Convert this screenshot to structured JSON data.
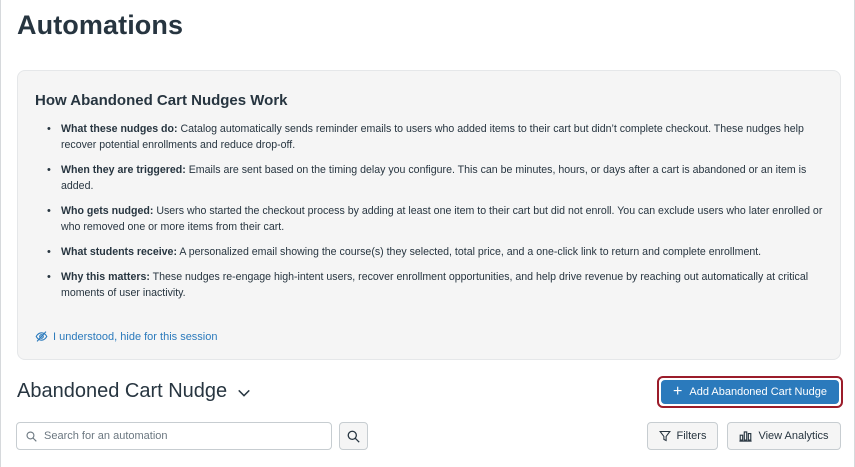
{
  "page": {
    "title": "Automations"
  },
  "info_panel": {
    "title": "How Abandoned Cart Nudges Work",
    "items": [
      {
        "label": "What these nudges do:",
        "text": " Catalog automatically sends reminder emails to users who added items to their cart but didn’t complete checkout. These nudges help recover potential enrollments and reduce drop-off."
      },
      {
        "label": "When they are triggered:",
        "text": " Emails are sent based on the timing delay you configure. This can be minutes, hours, or days after a cart is abandoned or an item is added."
      },
      {
        "label": "Who gets nudged:",
        "text": " Users who started the checkout process by adding at least one item to their cart but did not enroll. You can exclude users who later enrolled or who removed one or more items from their cart."
      },
      {
        "label": "What students receive:",
        "text": " A personalized email showing the course(s) they selected, total price, and a one-click link to return and complete enrollment."
      },
      {
        "label": "Why this matters:",
        "text": " These nudges re-engage high-intent users, recover enrollment opportunities, and help drive revenue by reaching out automatically at critical moments of user inactivity."
      }
    ],
    "hide_link": "I understood, hide for this session",
    "hide_icon": "eye-slash-icon"
  },
  "section": {
    "title": "Abandoned Cart Nudge",
    "dropdown_icon": "chevron-down-icon"
  },
  "toolbar": {
    "add_button": "Add Abandoned Cart Nudge",
    "search_placeholder": "Search for an automation",
    "search_value": "",
    "filters_button": "Filters",
    "analytics_button": "View Analytics"
  },
  "colors": {
    "primary": "#2b7abc",
    "highlight_border": "#9b1c2a",
    "text": "#273540",
    "panel_bg": "#f5f5f5"
  }
}
